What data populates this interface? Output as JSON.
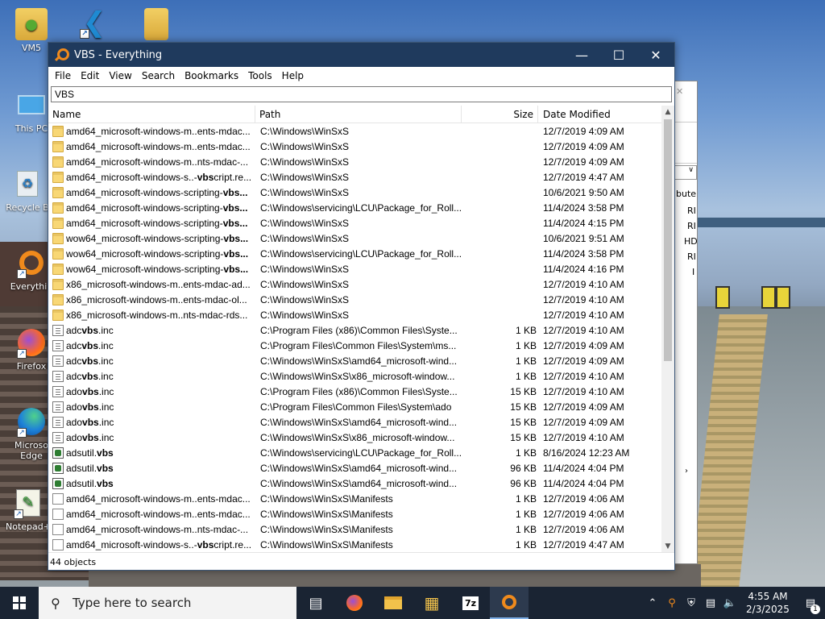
{
  "desktop": {
    "icons": [
      {
        "label": "VM5",
        "icon": "user-folder-icon"
      },
      {
        "label": "",
        "icon": "vscode-icon"
      },
      {
        "label": "",
        "icon": "folder-icon"
      },
      {
        "label": "This PC",
        "icon": "computer-icon"
      },
      {
        "label": "Recycle B",
        "icon": "recycle-bin-icon"
      },
      {
        "label": "Everythin",
        "icon": "everything-icon"
      },
      {
        "label": "Firefox",
        "icon": "firefox-icon"
      },
      {
        "label": "Microso Edge",
        "icon": "edge-icon"
      },
      {
        "label": "Notepad+",
        "icon": "notepadpp-icon"
      }
    ],
    "background_window_text": [
      "bute",
      "RI",
      "RI",
      "HD",
      "RI",
      "I"
    ]
  },
  "window": {
    "title": "VBS - Everything",
    "menu": [
      "File",
      "Edit",
      "View",
      "Search",
      "Bookmarks",
      "Tools",
      "Help"
    ],
    "search_value": "VBS",
    "columns": {
      "name": "Name",
      "path": "Path",
      "size": "Size",
      "date": "Date Modified"
    },
    "rows": [
      {
        "type": "folder",
        "pre": "amd64_microsoft-windows-m..ents-mdac...",
        "hl": "",
        "post": "",
        "path": "C:\\Windows\\WinSxS",
        "size": "",
        "date": "12/7/2019 4:09 AM"
      },
      {
        "type": "folder",
        "pre": "amd64_microsoft-windows-m..ents-mdac...",
        "hl": "",
        "post": "",
        "path": "C:\\Windows\\WinSxS",
        "size": "",
        "date": "12/7/2019 4:09 AM"
      },
      {
        "type": "folder",
        "pre": "amd64_microsoft-windows-m..nts-mdac-...",
        "hl": "",
        "post": "",
        "path": "C:\\Windows\\WinSxS",
        "size": "",
        "date": "12/7/2019 4:09 AM"
      },
      {
        "type": "folder",
        "pre": "amd64_microsoft-windows-s..-",
        "hl": "vbs",
        "post": "cript.re...",
        "path": "C:\\Windows\\WinSxS",
        "size": "",
        "date": "12/7/2019 4:47 AM"
      },
      {
        "type": "folder",
        "pre": "amd64_microsoft-windows-scripting-",
        "hl": "vbs...",
        "post": "",
        "path": "C:\\Windows\\WinSxS",
        "size": "",
        "date": "10/6/2021 9:50 AM"
      },
      {
        "type": "folder",
        "pre": "amd64_microsoft-windows-scripting-",
        "hl": "vbs...",
        "post": "",
        "path": "C:\\Windows\\servicing\\LCU\\Package_for_Roll...",
        "size": "",
        "date": "11/4/2024 3:58 PM"
      },
      {
        "type": "folder",
        "pre": "amd64_microsoft-windows-scripting-",
        "hl": "vbs...",
        "post": "",
        "path": "C:\\Windows\\WinSxS",
        "size": "",
        "date": "11/4/2024 4:15 PM"
      },
      {
        "type": "folder",
        "pre": "wow64_microsoft-windows-scripting-",
        "hl": "vbs...",
        "post": "",
        "path": "C:\\Windows\\WinSxS",
        "size": "",
        "date": "10/6/2021 9:51 AM"
      },
      {
        "type": "folder",
        "pre": "wow64_microsoft-windows-scripting-",
        "hl": "vbs...",
        "post": "",
        "path": "C:\\Windows\\servicing\\LCU\\Package_for_Roll...",
        "size": "",
        "date": "11/4/2024 3:58 PM"
      },
      {
        "type": "folder",
        "pre": "wow64_microsoft-windows-scripting-",
        "hl": "vbs...",
        "post": "",
        "path": "C:\\Windows\\WinSxS",
        "size": "",
        "date": "11/4/2024 4:16 PM"
      },
      {
        "type": "folder",
        "pre": "x86_microsoft-windows-m..ents-mdac-ad...",
        "hl": "",
        "post": "",
        "path": "C:\\Windows\\WinSxS",
        "size": "",
        "date": "12/7/2019 4:10 AM"
      },
      {
        "type": "folder",
        "pre": "x86_microsoft-windows-m..ents-mdac-ol...",
        "hl": "",
        "post": "",
        "path": "C:\\Windows\\WinSxS",
        "size": "",
        "date": "12/7/2019 4:10 AM"
      },
      {
        "type": "folder",
        "pre": "x86_microsoft-windows-m..nts-mdac-rds...",
        "hl": "",
        "post": "",
        "path": "C:\\Windows\\WinSxS",
        "size": "",
        "date": "12/7/2019 4:10 AM"
      },
      {
        "type": "file",
        "pre": "adc",
        "hl": "vbs",
        "post": ".inc",
        "path": "C:\\Program Files (x86)\\Common Files\\Syste...",
        "size": "1 KB",
        "date": "12/7/2019 4:10 AM"
      },
      {
        "type": "file",
        "pre": "adc",
        "hl": "vbs",
        "post": ".inc",
        "path": "C:\\Program Files\\Common Files\\System\\ms...",
        "size": "1 KB",
        "date": "12/7/2019 4:09 AM"
      },
      {
        "type": "file",
        "pre": "adc",
        "hl": "vbs",
        "post": ".inc",
        "path": "C:\\Windows\\WinSxS\\amd64_microsoft-wind...",
        "size": "1 KB",
        "date": "12/7/2019 4:09 AM"
      },
      {
        "type": "file",
        "pre": "adc",
        "hl": "vbs",
        "post": ".inc",
        "path": "C:\\Windows\\WinSxS\\x86_microsoft-window...",
        "size": "1 KB",
        "date": "12/7/2019 4:10 AM"
      },
      {
        "type": "file",
        "pre": "ado",
        "hl": "vbs",
        "post": ".inc",
        "path": "C:\\Program Files (x86)\\Common Files\\Syste...",
        "size": "15 KB",
        "date": "12/7/2019 4:10 AM"
      },
      {
        "type": "file",
        "pre": "ado",
        "hl": "vbs",
        "post": ".inc",
        "path": "C:\\Program Files\\Common Files\\System\\ado",
        "size": "15 KB",
        "date": "12/7/2019 4:09 AM"
      },
      {
        "type": "file",
        "pre": "ado",
        "hl": "vbs",
        "post": ".inc",
        "path": "C:\\Windows\\WinSxS\\amd64_microsoft-wind...",
        "size": "15 KB",
        "date": "12/7/2019 4:09 AM"
      },
      {
        "type": "file",
        "pre": "ado",
        "hl": "vbs",
        "post": ".inc",
        "path": "C:\\Windows\\WinSxS\\x86_microsoft-window...",
        "size": "15 KB",
        "date": "12/7/2019 4:10 AM"
      },
      {
        "type": "script",
        "pre": "adsutil.",
        "hl": "vbs",
        "post": "",
        "path": "C:\\Windows\\servicing\\LCU\\Package_for_Roll...",
        "size": "1 KB",
        "date": "8/16/2024 12:23 AM"
      },
      {
        "type": "script",
        "pre": "adsutil.",
        "hl": "vbs",
        "post": "",
        "path": "C:\\Windows\\WinSxS\\amd64_microsoft-wind...",
        "size": "96 KB",
        "date": "11/4/2024 4:04 PM"
      },
      {
        "type": "script",
        "pre": "adsutil.",
        "hl": "vbs",
        "post": "",
        "path": "C:\\Windows\\WinSxS\\amd64_microsoft-wind...",
        "size": "96 KB",
        "date": "11/4/2024 4:04 PM"
      },
      {
        "type": "blank",
        "pre": "amd64_microsoft-windows-m..ents-mdac...",
        "hl": "",
        "post": "",
        "path": "C:\\Windows\\WinSxS\\Manifests",
        "size": "1 KB",
        "date": "12/7/2019 4:06 AM"
      },
      {
        "type": "blank",
        "pre": "amd64_microsoft-windows-m..ents-mdac...",
        "hl": "",
        "post": "",
        "path": "C:\\Windows\\WinSxS\\Manifests",
        "size": "1 KB",
        "date": "12/7/2019 4:06 AM"
      },
      {
        "type": "blank",
        "pre": "amd64_microsoft-windows-m..nts-mdac-...",
        "hl": "",
        "post": "",
        "path": "C:\\Windows\\WinSxS\\Manifests",
        "size": "1 KB",
        "date": "12/7/2019 4:06 AM"
      },
      {
        "type": "blank",
        "pre": "amd64_microsoft-windows-s..-",
        "hl": "vbs",
        "post": "cript.re...",
        "path": "C:\\Windows\\WinSxS\\Manifests",
        "size": "1 KB",
        "date": "12/7/2019 4:47 AM"
      }
    ],
    "status": "44 objects"
  },
  "taskbar": {
    "search_placeholder": "Type here to search",
    "apps": [
      "task-view-icon",
      "firefox-icon",
      "file-explorer-icon",
      "network-app-icon",
      "7zip-icon",
      "everything-icon"
    ],
    "app_7z_label": "7z",
    "time": "4:55 AM",
    "date": "2/3/2025",
    "notification_count": "1"
  }
}
